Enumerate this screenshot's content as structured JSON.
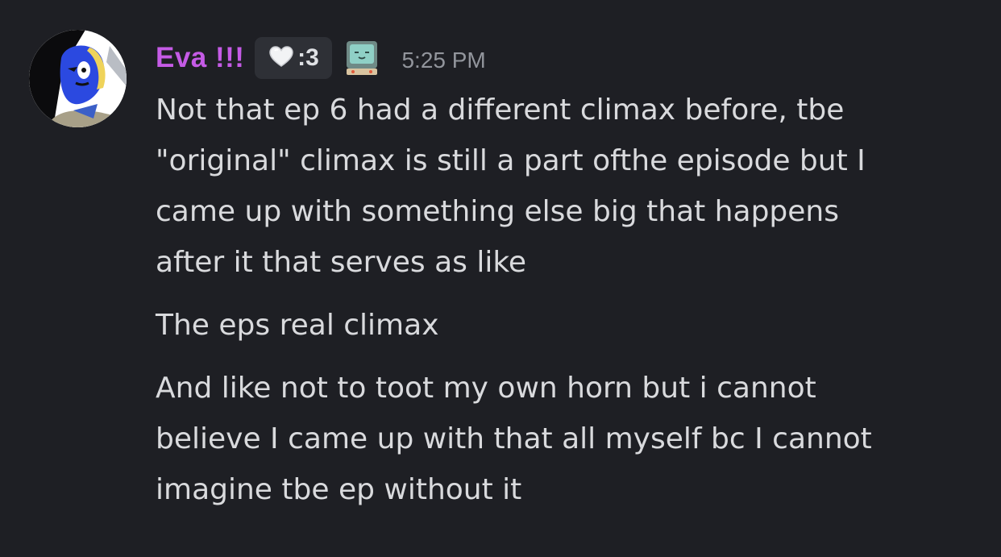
{
  "message": {
    "author": {
      "name": "Eva !!!",
      "name_color": "#c55be6",
      "tag_icon": "heart-icon",
      "tag_text": ":3",
      "badge_icon": "tv-face-icon"
    },
    "timestamp": "5:25 PM",
    "paragraphs": [
      "Not that ep 6 had a different climax before, tbe\n\"original\" climax is still a part ofthe episode but I\ncame up with something else big that happens\nafter it that serves as like",
      "The eps real climax",
      "And like not to toot my own horn but i cannot\nbelieve I came up with that all myself bc I cannot\nimagine tbe ep without it"
    ]
  },
  "colors": {
    "background": "#1e1f24",
    "text": "#d9dadd",
    "timestamp": "#92959c",
    "tag_background": "#2e3036"
  }
}
